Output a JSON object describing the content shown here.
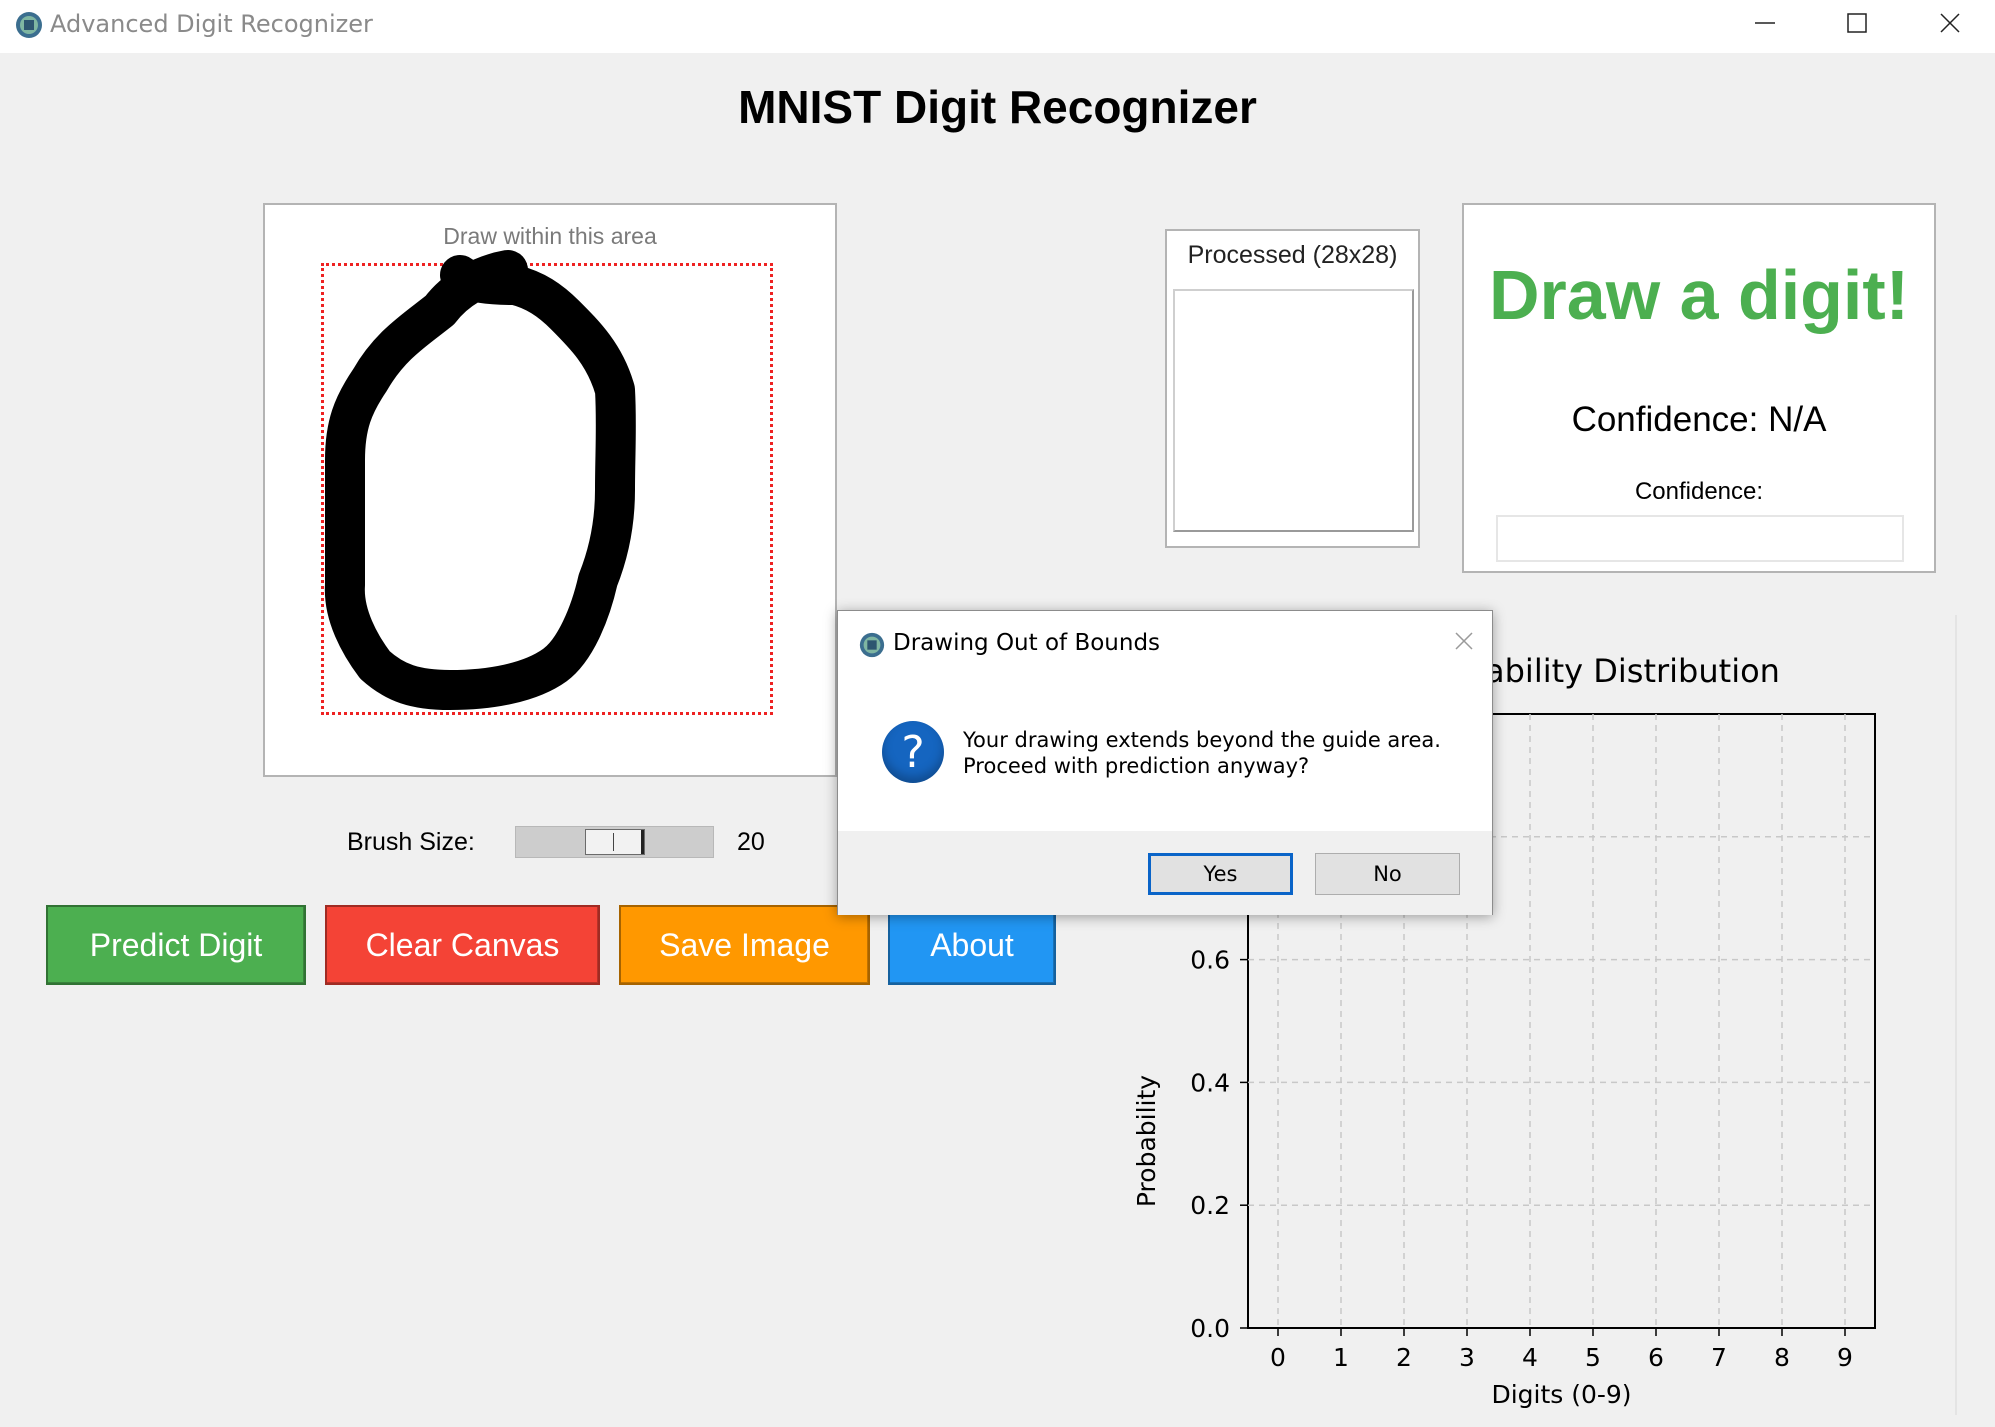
{
  "window": {
    "title": "Advanced Digit Recognizer",
    "controls": [
      "minimize",
      "maximize",
      "close"
    ]
  },
  "header": {
    "title": "MNIST Digit Recognizer"
  },
  "canvas": {
    "guide_label": "Draw within this area",
    "stroke_color": "#000000",
    "guide_color": "#e02020",
    "drawn_digit_shape": "0"
  },
  "brush": {
    "label": "Brush Size:",
    "value": "20",
    "level": 0.4
  },
  "buttons": {
    "predict": "Predict Digit",
    "clear": "Clear Canvas",
    "save": "Save Image",
    "about": "About"
  },
  "button_colors": {
    "predict": "#4caf50",
    "clear": "#f44336",
    "save": "#ff9800",
    "about": "#2196f3"
  },
  "processed": {
    "label": "Processed (28x28)"
  },
  "result": {
    "prediction": "Draw a digit!",
    "prediction_color": "#4caf50",
    "confidence_text": "Confidence: N/A",
    "confidence_label": "Confidence:",
    "confidence_fill": 0
  },
  "dialog": {
    "title": "Drawing Out of Bounds",
    "message_line1": "Your drawing extends beyond the guide area.",
    "message_line2": "Proceed with prediction anyway?",
    "icon": "question-icon",
    "yes_label": "Yes",
    "no_label": "No"
  },
  "chart_data": {
    "type": "bar",
    "title": "Probability Distribution",
    "visible_title_fragment": "ability Distribution",
    "xlabel": "Digits (0-9)",
    "ylabel": "Probability",
    "categories": [
      "0",
      "1",
      "2",
      "3",
      "4",
      "5",
      "6",
      "7",
      "8",
      "9"
    ],
    "values": [
      0,
      0,
      0,
      0,
      0,
      0,
      0,
      0,
      0,
      0
    ],
    "y_ticks": [
      "0.0",
      "0.2",
      "0.4",
      "0.6"
    ],
    "ylim": [
      0,
      1
    ],
    "grid": true
  }
}
